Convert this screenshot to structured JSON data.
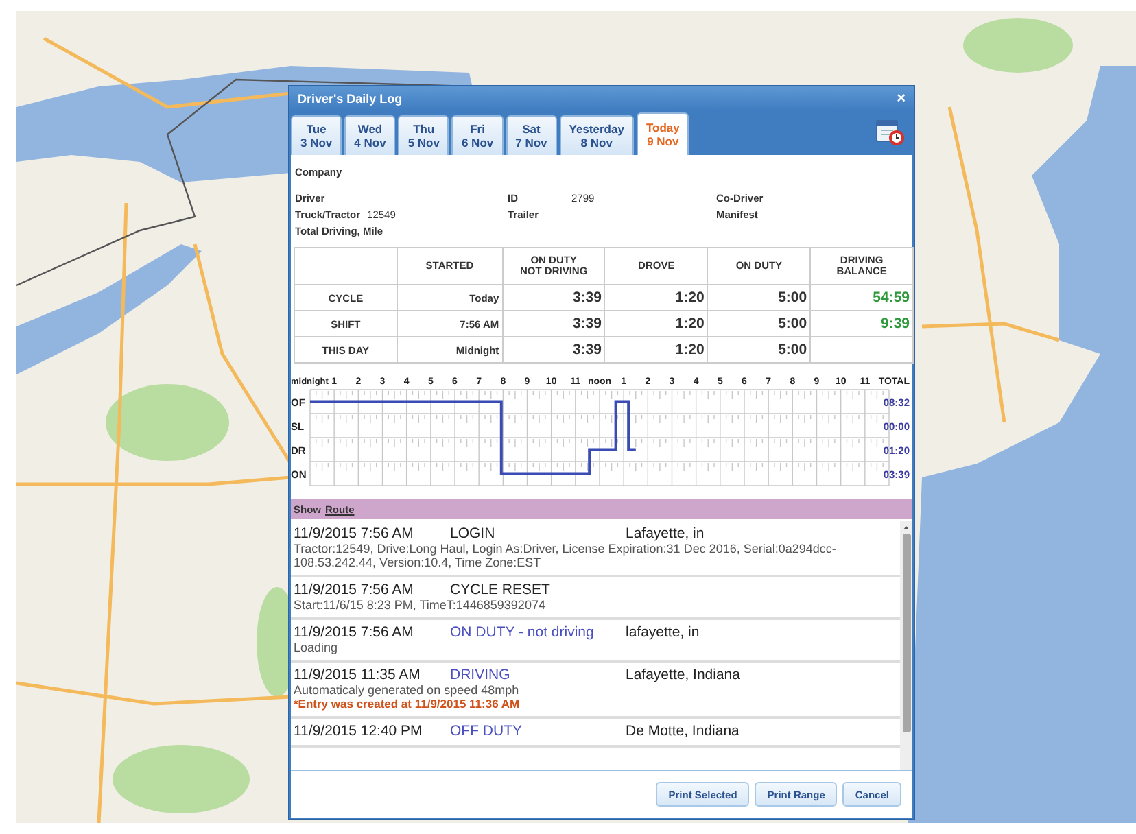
{
  "window": {
    "title": "Driver's Daily Log",
    "close": "×"
  },
  "tabs": [
    {
      "day": "Tue",
      "date": "3 Nov",
      "selected": false
    },
    {
      "day": "Wed",
      "date": "4 Nov",
      "selected": false
    },
    {
      "day": "Thu",
      "date": "5 Nov",
      "selected": false
    },
    {
      "day": "Fri",
      "date": "6 Nov",
      "selected": false
    },
    {
      "day": "Sat",
      "date": "7 Nov",
      "selected": false
    },
    {
      "day": "Yesterday",
      "date": "8 Nov",
      "selected": false
    },
    {
      "day": "Today",
      "date": "9 Nov",
      "selected": true
    }
  ],
  "info": [
    [
      {
        "label": "Company"
      }
    ],
    [
      {
        "label": "Driver"
      },
      {
        "label": "ID",
        "value": "2799"
      },
      {
        "label": "Co-Driver"
      }
    ],
    [
      {
        "label": "Truck/Tractor",
        "value": "12549"
      },
      {
        "label": "Trailer"
      },
      {
        "label": "Manifest"
      }
    ],
    [
      {
        "label": "Total Driving, Mile"
      }
    ]
  ],
  "hours_table": {
    "columns": [
      "",
      "STARTED",
      "ON DUTY\nNOT DRIVING",
      "DROVE",
      "ON DUTY",
      "DRIVING\nBALANCE"
    ],
    "rows": [
      [
        "CYCLE",
        "Today",
        "3:39",
        "1:20",
        "5:00",
        "54:59"
      ],
      [
        "SHIFT",
        "7:56 AM",
        "3:39",
        "1:20",
        "5:00",
        "9:39"
      ],
      [
        "THIS DAY",
        "Midnight",
        "3:39",
        "1:20",
        "5:00"
      ]
    ]
  },
  "duty_graph": {
    "hour_labels": [
      "midnight",
      "1",
      "2",
      "3",
      "4",
      "5",
      "6",
      "7",
      "8",
      "9",
      "10",
      "11",
      "noon",
      "1",
      "2",
      "3",
      "4",
      "5",
      "6",
      "7",
      "8",
      "9",
      "10",
      "11"
    ],
    "totals_heading": "TOTAL",
    "rows": [
      {
        "label": "OF",
        "total": "08:32"
      },
      {
        "label": "SL",
        "total": "00:00"
      },
      {
        "label": "DR",
        "total": "01:20"
      },
      {
        "label": "ON",
        "total": "03:39"
      }
    ]
  },
  "route_bar": {
    "label": "Show",
    "link": "Route"
  },
  "log": [
    {
      "time": "11/9/2015 7:56 AM",
      "event": "LOGIN",
      "kind": "system",
      "location": "Lafayette, in",
      "details": "Tractor:12549, Drive:Long Haul, Login As:Driver, License Expiration:31 Dec 2016, Serial:0a294dcc-108.53.242.44, Version:10.4, Time Zone:EST"
    },
    {
      "time": "11/9/2015 7:56 AM",
      "event": "CYCLE RESET",
      "kind": "system",
      "details": "Start:11/6/15 8:23 PM, TimeT:1446859392074"
    },
    {
      "time": "11/9/2015 7:56 AM",
      "event": "ON DUTY - not driving",
      "kind": "status",
      "location": "lafayette, in",
      "details": "Loading"
    },
    {
      "time": "11/9/2015 11:35 AM",
      "event": "DRIVING",
      "kind": "status",
      "location": "Lafayette, Indiana",
      "details": "Automaticaly generated on speed 48mph",
      "note": "*Entry was created at 11/9/2015 11:36 AM"
    },
    {
      "time": "11/9/2015 12:40 PM",
      "event": "OFF DUTY",
      "kind": "status",
      "location": "De Motte, Indiana"
    }
  ],
  "buttons": [
    "Print Selected",
    "Print Range",
    "Cancel"
  ]
}
